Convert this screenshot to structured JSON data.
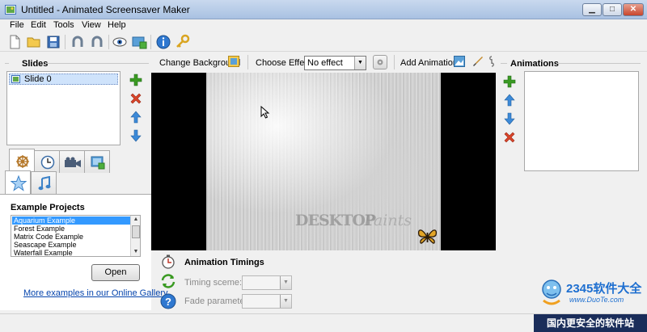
{
  "window": {
    "title": "Untitled - Animated Screensaver Maker",
    "buttons": {
      "minimize": "▁",
      "maximize": "□",
      "close": "✕"
    }
  },
  "menu": [
    "File",
    "Edit",
    "Tools",
    "View",
    "Help"
  ],
  "toolbar": {
    "icons": [
      "new-file-icon",
      "open-folder-icon",
      "save-icon",
      "undo-icon",
      "redo-icon",
      "preview-eye-icon",
      "export-icon",
      "info-icon",
      "key-icon"
    ]
  },
  "slides": {
    "heading": "Slides",
    "items": [
      {
        "label": "Slide 0"
      }
    ]
  },
  "tabs": [
    "settings-wheel-icon",
    "clock-icon",
    "film-camera-icon",
    "image-export-icon",
    "star-icon",
    "music-note-icon"
  ],
  "examples": {
    "heading": "Example Projects",
    "items": [
      "Aquarium Example",
      "Forest Example",
      "Matrix Code Example",
      "Seascape Example",
      "Waterfall Example"
    ],
    "selected_index": 0,
    "open_label": "Open",
    "gallery_link": "More examples in our Online Gallery"
  },
  "center_toolbar": {
    "change_background": "Change Background",
    "choose_effect_label": "Choose Effect:",
    "effect_value": "No effect",
    "add_animation": "Add Animation"
  },
  "preview": {
    "watermark_bold": "DESKTOP",
    "watermark_italic": "Paints"
  },
  "timings": {
    "heading": "Animation Timings",
    "timing_scheme_label": "Timing sceme:",
    "fade_parameter_label": "Fade parameter:"
  },
  "animations": {
    "heading": "Animations"
  },
  "brand": {
    "logo_text": "2345软件大全",
    "logo_sub": "www.DuoTe.com",
    "bar_text": "国内更安全的软件站"
  },
  "colors": {
    "title_bar": "#b9cde9",
    "selection": "#3399ff",
    "link": "#0645ad",
    "add": "#3a9a22",
    "remove": "#d9442a",
    "arrow": "#3c8ad8"
  }
}
